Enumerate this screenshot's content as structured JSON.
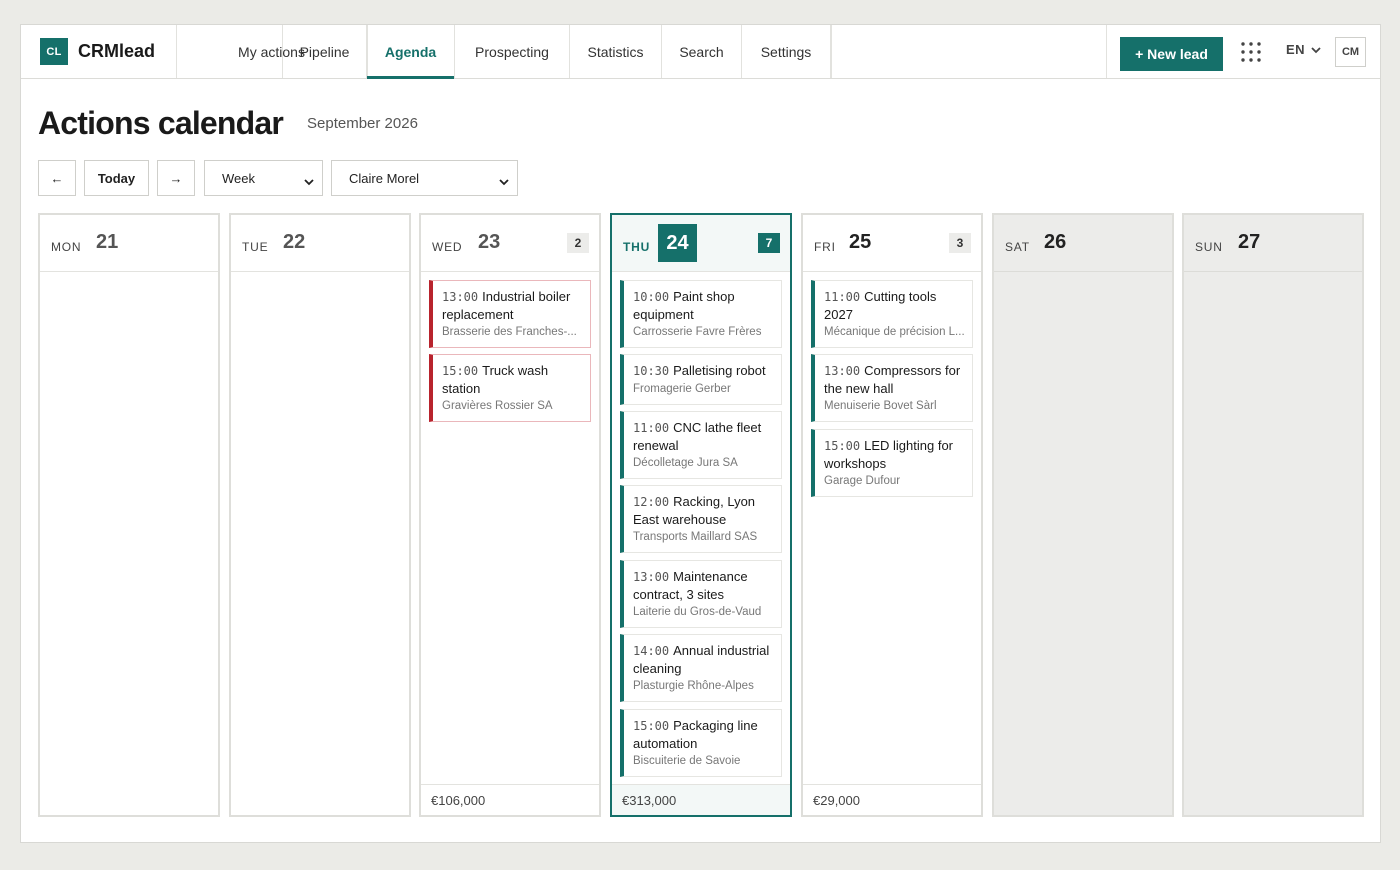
{
  "brand": {
    "logo": "CL",
    "name": "CRMlead"
  },
  "nav": {
    "tabs": [
      {
        "label": "My actions",
        "active": false
      },
      {
        "label": "Pipeline",
        "active": false
      },
      {
        "label": "Agenda",
        "active": true
      },
      {
        "label": "Prospecting",
        "active": false
      },
      {
        "label": "Statistics",
        "active": false
      },
      {
        "label": "Search",
        "active": false
      },
      {
        "label": "Settings",
        "active": false
      }
    ],
    "new_lead": "+ New lead",
    "apps_icon": "grid-icon",
    "language": "EN",
    "avatar": "CM"
  },
  "header": {
    "title": "Actions calendar",
    "subtitle": "September 2026"
  },
  "toolbar": {
    "prev": "←",
    "today": "Today",
    "next": "→",
    "view": "Week",
    "user": "Claire Morel"
  },
  "colors": {
    "accent": "#15706a",
    "alert": "#b8232d"
  },
  "days": [
    {
      "name": "MON",
      "num": "21",
      "count": "",
      "total": "",
      "events": []
    },
    {
      "name": "TUE",
      "num": "22",
      "count": "",
      "total": "",
      "events": []
    },
    {
      "name": "WED",
      "num": "23",
      "count": "2",
      "total": "€106,000",
      "events": [
        {
          "time": "13:00",
          "title": "Industrial boiler replacement",
          "company": "Brasserie des Franches-...",
          "overdue": true
        },
        {
          "time": "15:00",
          "title": "Truck wash station",
          "company": "Gravières Rossier SA",
          "overdue": true
        }
      ]
    },
    {
      "name": "THU",
      "num": "24",
      "count": "7",
      "total": "€313,000",
      "today": true,
      "events": [
        {
          "time": "10:00",
          "title": "Paint shop equipment",
          "company": "Carrosserie Favre Frères"
        },
        {
          "time": "10:30",
          "title": "Palletising robot",
          "company": "Fromagerie Gerber"
        },
        {
          "time": "11:00",
          "title": "CNC lathe fleet renewal",
          "company": "Décolletage Jura SA"
        },
        {
          "time": "12:00",
          "title": "Racking, Lyon East warehouse",
          "company": "Transports Maillard SAS"
        },
        {
          "time": "13:00",
          "title": "Maintenance contract, 3 sites",
          "company": "Laiterie du Gros-de-Vaud"
        },
        {
          "time": "14:00",
          "title": "Annual industrial cleaning",
          "company": "Plasturgie Rhône-Alpes"
        },
        {
          "time": "15:00",
          "title": "Packaging line automation",
          "company": "Biscuiterie de Savoie"
        }
      ]
    },
    {
      "name": "FRI",
      "num": "25",
      "count": "3",
      "total": "€29,000",
      "events": [
        {
          "time": "11:00",
          "title": "Cutting tools 2027",
          "company": "Mécanique de précision L..."
        },
        {
          "time": "13:00",
          "title": "Compressors for the new hall",
          "company": "Menuiserie Bovet Sàrl"
        },
        {
          "time": "15:00",
          "title": "LED lighting for workshops",
          "company": "Garage Dufour"
        }
      ]
    },
    {
      "name": "SAT",
      "num": "26",
      "count": "",
      "total": "",
      "events": []
    },
    {
      "name": "SUN",
      "num": "27",
      "count": "",
      "total": "",
      "events": []
    }
  ]
}
